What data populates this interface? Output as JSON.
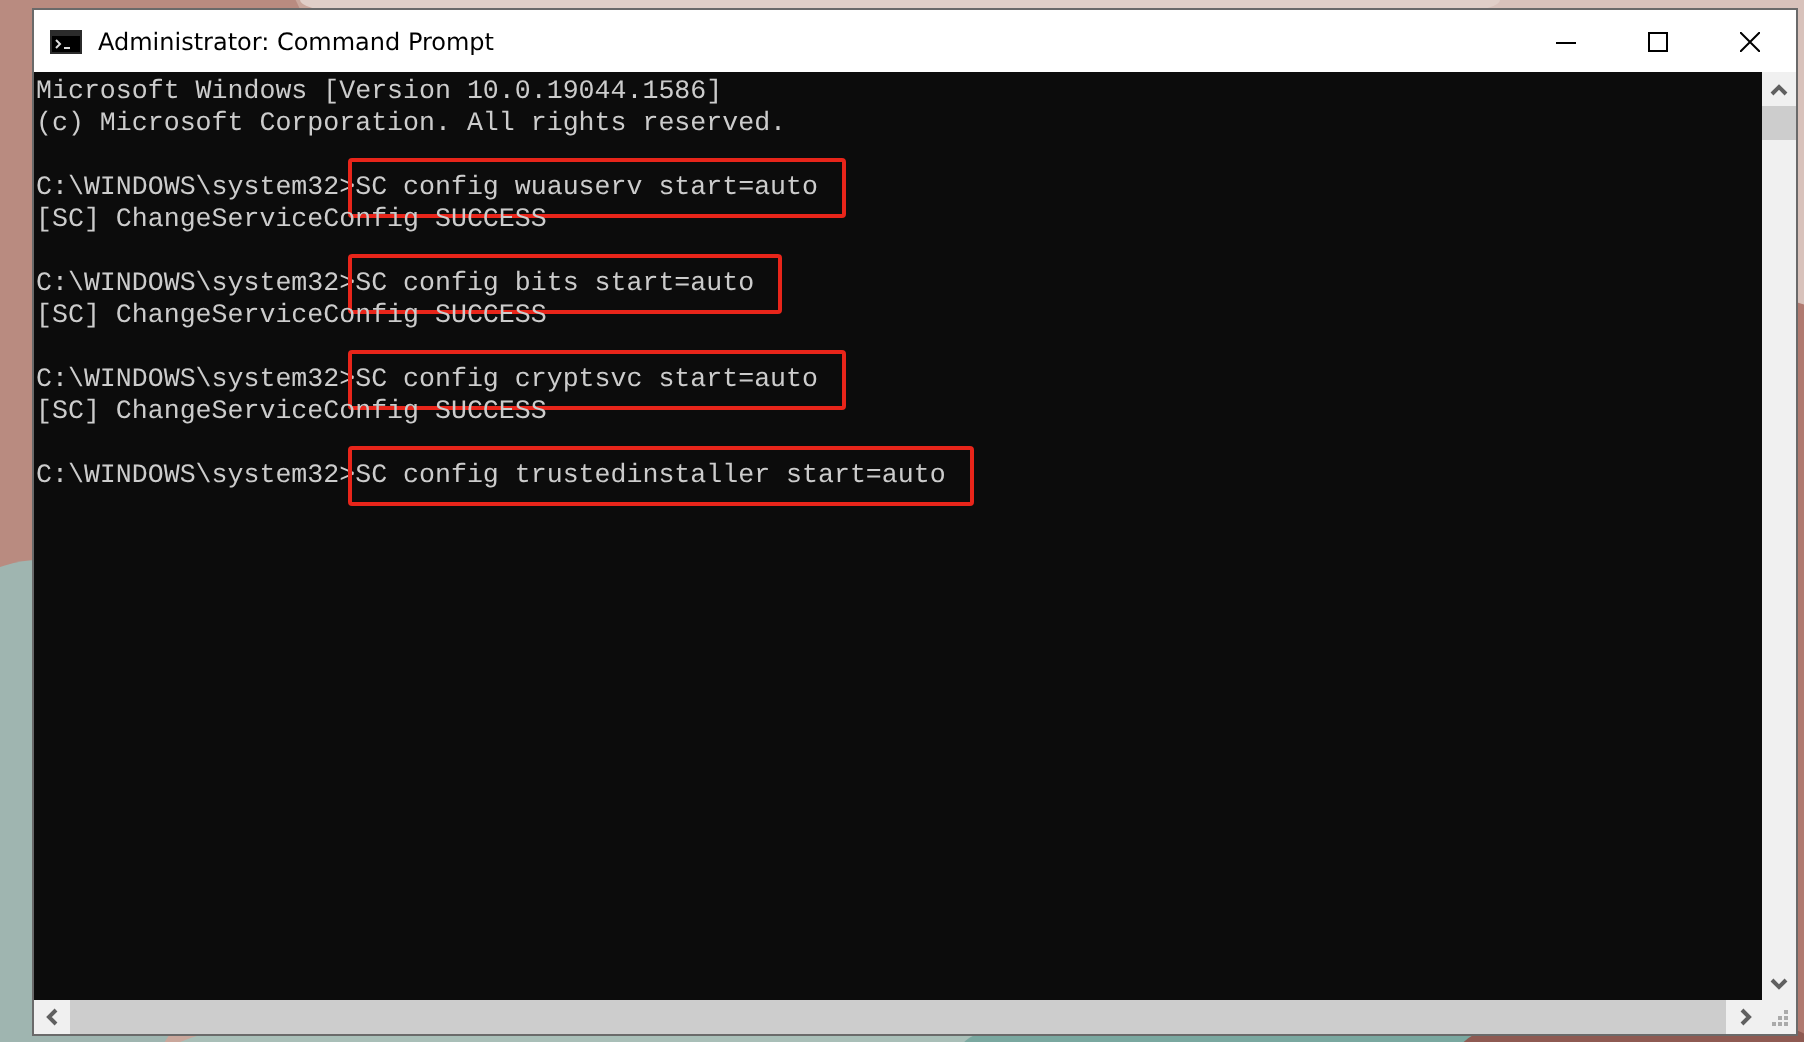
{
  "window": {
    "title": "Administrator: Command Prompt"
  },
  "console": {
    "lines": [
      {
        "kind": "output",
        "text": "Microsoft Windows [Version 10.0.19044.1586]"
      },
      {
        "kind": "output",
        "text": "(c) Microsoft Corporation. All rights reserved."
      },
      {
        "kind": "blank"
      },
      {
        "kind": "prompt",
        "prompt": "C:\\WINDOWS\\system32>",
        "command": "SC config wuauserv start=auto",
        "highlighted": true
      },
      {
        "kind": "output",
        "text": "[SC] ChangeServiceConfig SUCCESS"
      },
      {
        "kind": "blank"
      },
      {
        "kind": "prompt",
        "prompt": "C:\\WINDOWS\\system32>",
        "command": "SC config bits start=auto",
        "highlighted": true
      },
      {
        "kind": "output",
        "text": "[SC] ChangeServiceConfig SUCCESS"
      },
      {
        "kind": "blank"
      },
      {
        "kind": "prompt",
        "prompt": "C:\\WINDOWS\\system32>",
        "command": "SC config cryptsvc start=auto",
        "highlighted": true
      },
      {
        "kind": "output",
        "text": "[SC] ChangeServiceConfig SUCCESS"
      },
      {
        "kind": "blank"
      },
      {
        "kind": "prompt",
        "prompt": "C:\\WINDOWS\\system32>",
        "command": "SC config trustedinstaller start=auto",
        "highlighted": true
      }
    ]
  }
}
